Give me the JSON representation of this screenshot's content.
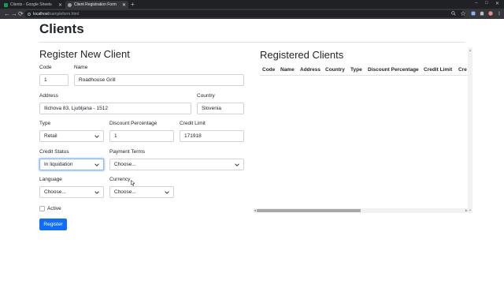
{
  "browser": {
    "tabs": [
      {
        "title": "Clients - Google Sheets",
        "favicon_color": "#0f9d58"
      },
      {
        "title": "Client Registration Form",
        "favicon_color": "#9aa0a6"
      }
    ],
    "new_tab_symbol": "+",
    "window_controls": {
      "minimize": "–",
      "maximize": "□",
      "close": "✕"
    },
    "url_host": "localhost",
    "url_path": "/sampleform.html",
    "nav": {
      "back": "←",
      "forward": "→",
      "reload": "⟳"
    }
  },
  "page": {
    "title": "Clients",
    "form": {
      "heading": "Register New Client",
      "code": {
        "label": "Code",
        "value": "1"
      },
      "name": {
        "label": "Name",
        "value": "Roadhouse Grill"
      },
      "address": {
        "label": "Address",
        "value": "Ilichova 83, Ljubljana - 1512"
      },
      "country": {
        "label": "Country",
        "value": "Slovenia"
      },
      "type": {
        "label": "Type",
        "value": "Retail"
      },
      "discount": {
        "label": "Discount Percentage",
        "value": "1"
      },
      "credit_limit": {
        "label": "Credit Limit",
        "value": "171918"
      },
      "credit_status": {
        "label": "Credit Status",
        "value": "In liquidation"
      },
      "payment_terms": {
        "label": "Payment Terms",
        "value": "Choose..."
      },
      "language": {
        "label": "Language",
        "value": "Choose..."
      },
      "currency": {
        "label": "Currency",
        "value": "Choose..."
      },
      "active": {
        "label": "Active",
        "checked": false
      },
      "submit_label": "Register"
    },
    "registered": {
      "heading": "Registered Clients",
      "columns": [
        "Code",
        "Name",
        "Address",
        "Country",
        "Type",
        "Discount Percentage",
        "Credit Limit",
        "Cre"
      ]
    }
  },
  "colors": {
    "primary": "#0d6efd",
    "focus_border": "#86b7fe",
    "chrome_dark": "#202124",
    "chrome_toolbar": "#35363a"
  }
}
